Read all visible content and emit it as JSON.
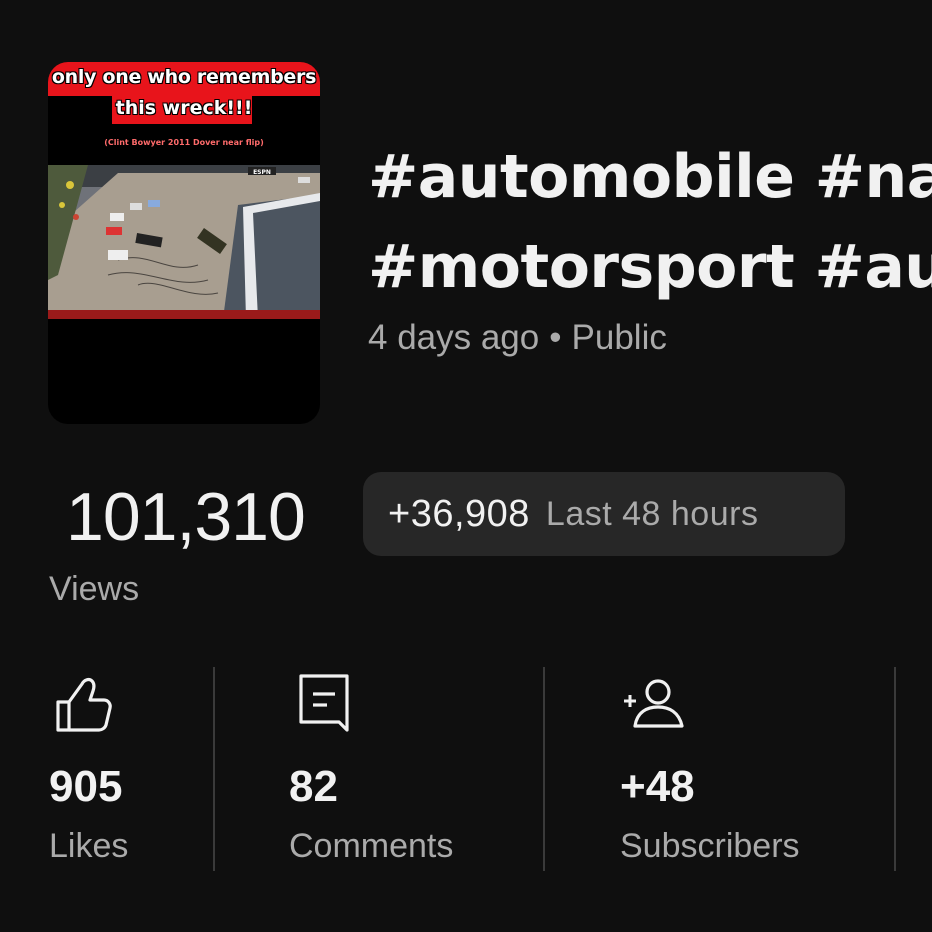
{
  "video": {
    "thumbnail": {
      "overlay_line1": "only one who remembers",
      "overlay_line2": "this wreck!!!",
      "overlay_sub": "(Clint Bowyer 2011 Dover near flip)",
      "network_logo": "ESPN"
    },
    "title_line1": "#automobile #na",
    "title_line2": "#motorsport #au",
    "age": "4 days ago",
    "separator": "•",
    "visibility": "Public"
  },
  "views": {
    "count": "101,310",
    "label": "Views",
    "delta": "+36,908",
    "delta_period": "Last 48 hours"
  },
  "stats": {
    "likes": {
      "value": "905",
      "label": "Likes",
      "icon": "thumbs-up-icon"
    },
    "comments": {
      "value": "82",
      "label": "Comments",
      "icon": "comment-icon"
    },
    "subscribers": {
      "value": "+48",
      "label": "Subscribers",
      "icon": "add-person-icon"
    }
  },
  "colors": {
    "background": "#0f0f0f",
    "text_primary": "#f1f1f1",
    "text_secondary": "#aaaaaa",
    "pill_background": "#272727",
    "thumbnail_banner": "#e8141b"
  }
}
